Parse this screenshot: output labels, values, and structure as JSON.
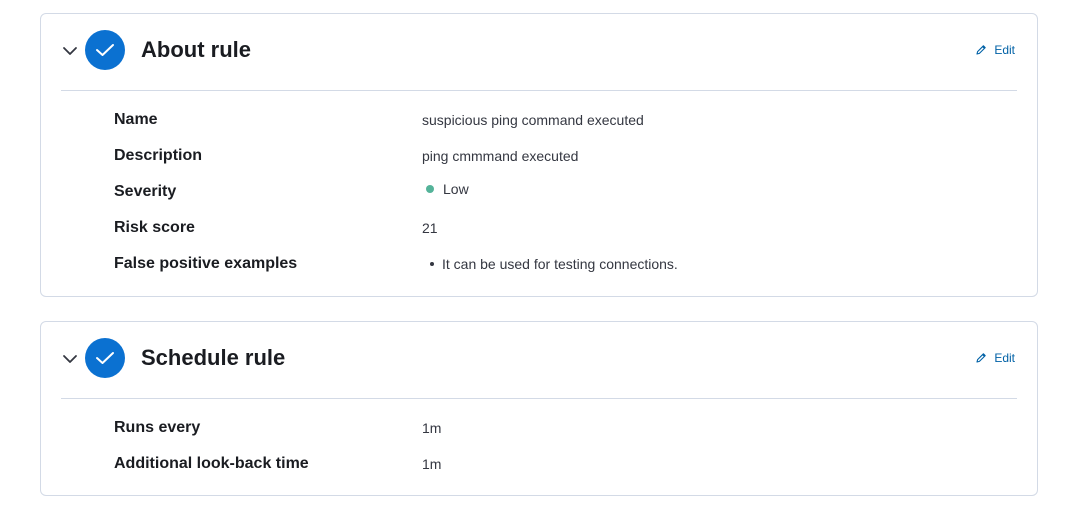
{
  "about": {
    "title": "About rule",
    "edit_label": "Edit",
    "rows": [
      {
        "label": "Name",
        "value": "suspicious ping command executed"
      },
      {
        "label": "Description",
        "value": "ping cmmmand executed"
      },
      {
        "label": "Severity",
        "value": "Low"
      },
      {
        "label": "Risk score",
        "value": "21"
      },
      {
        "label": "False positive examples",
        "value": "It can be used for testing connections."
      }
    ]
  },
  "schedule": {
    "title": "Schedule rule",
    "edit_label": "Edit",
    "rows": [
      {
        "label": "Runs every",
        "value": "1m"
      },
      {
        "label": "Additional look-back time",
        "value": "1m"
      }
    ]
  },
  "colors": {
    "accent": "#0b71d1",
    "link": "#0061a6",
    "severity_low": "#54b399",
    "border": "#d3dae6"
  },
  "icons": {
    "collapse": "chevron-down-icon",
    "step_complete": "check-icon",
    "edit": "pencil-icon"
  }
}
